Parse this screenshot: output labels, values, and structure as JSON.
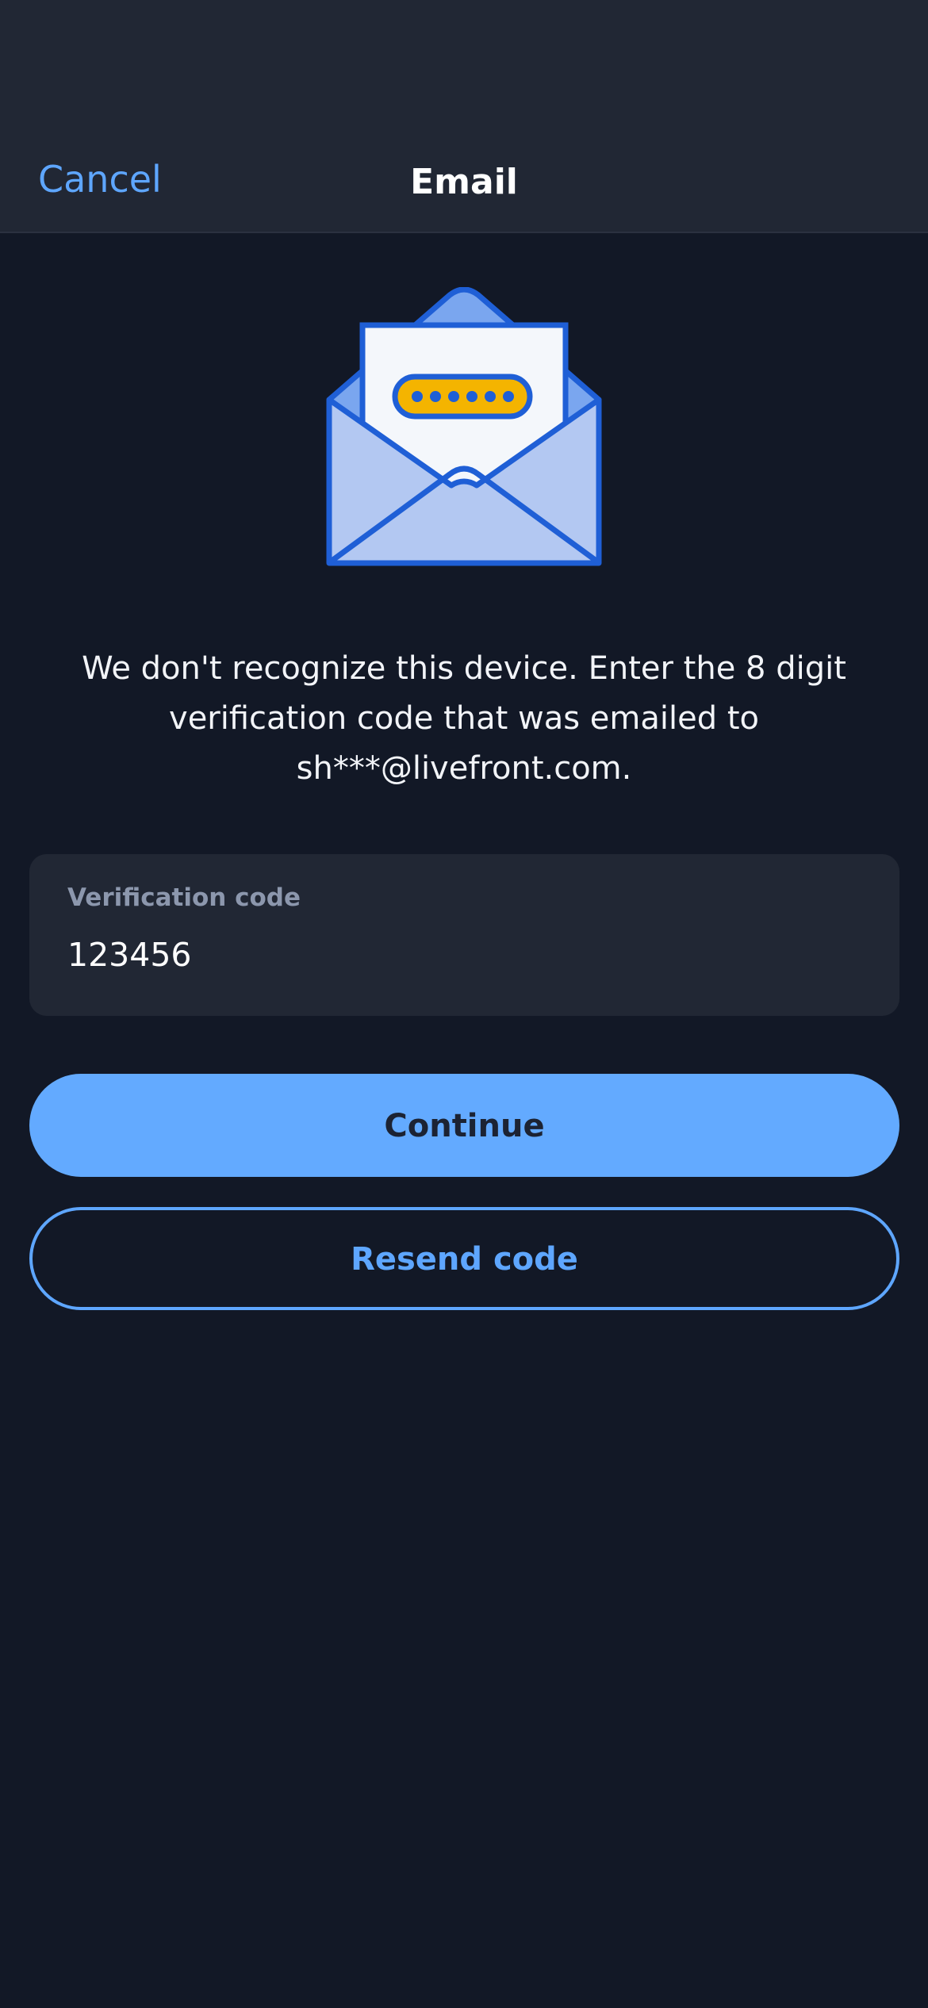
{
  "header": {
    "cancel_label": "Cancel",
    "title": "Email"
  },
  "illustration": {
    "icon": "open-envelope-with-code-letter-icon",
    "colors": {
      "stroke": "#1f5fd6",
      "envelope_back": "#7aa6ef",
      "envelope_front": "#b3c8f2",
      "letter": "#f4f7fb",
      "code_pill": "#f4b400"
    }
  },
  "message": {
    "text": "We don't recognize this device. Enter the 8 digit verification code that was emailed to sh***@livefront.com."
  },
  "verification_field": {
    "label": "Verification code",
    "value": "123456"
  },
  "actions": {
    "continue_label": "Continue",
    "resend_label": "Resend code"
  },
  "colors": {
    "background": "#121826",
    "surface": "#212734",
    "accent": "#63aaff",
    "link": "#5ea6ff",
    "label": "#8c97ad"
  }
}
